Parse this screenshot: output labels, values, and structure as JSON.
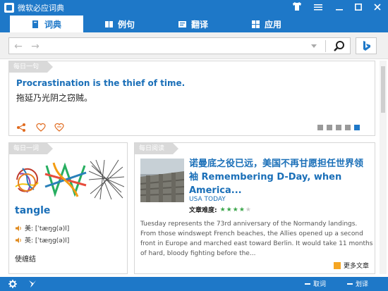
{
  "app": {
    "title": "微软必应词典"
  },
  "tabs": [
    {
      "label": "词典",
      "icon": "dictionary-icon",
      "active": true
    },
    {
      "label": "例句",
      "icon": "sentences-icon",
      "active": false
    },
    {
      "label": "翻译",
      "icon": "translate-icon",
      "active": false
    },
    {
      "label": "应用",
      "icon": "apps-icon",
      "active": false
    }
  ],
  "search": {
    "value": "",
    "placeholder": ""
  },
  "daily_sentence": {
    "tag": "每日一句",
    "english": "Procrastination is the thief of time.",
    "chinese": "拖延乃光阴之窃贼。",
    "carousel_count": 5,
    "carousel_active": 5
  },
  "daily_word": {
    "tag": "每日一词",
    "word": "tangle",
    "us_pron": "美: [ˈtæŋɡ(ə)l]",
    "uk_pron": "英: [ˈtæŋɡ(ə)l]",
    "definition": "使缠结"
  },
  "daily_reading": {
    "tag": "每日阅读",
    "title": "诺曼底之役已远，美国不再甘愿担任世界领袖  Remembering D-Day, when America...",
    "source": "USA TODAY",
    "difficulty_label": "文章难度:",
    "difficulty": 4,
    "difficulty_max": 5,
    "body": "Tuesday represents the 73rd anniversary of the Normandy landings. From those windswept French beaches, the Allies opened up a second front in Europe and marched east toward Berlin. It would take 11 months of hard, bloody fighting before the...",
    "more_label": "更多文章"
  },
  "bottom": {
    "clear_word": "取词",
    "select_word": "划译"
  },
  "colors": {
    "accent": "#1e78c8",
    "link": "#1a6fb8",
    "star_on": "#3aa54a",
    "more": "#f5a623"
  }
}
